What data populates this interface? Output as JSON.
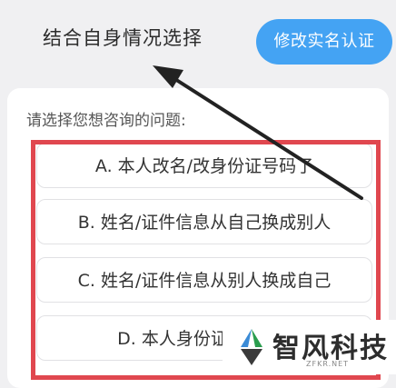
{
  "header": {
    "title": "结合自身情况选择",
    "verify_button": "修改实名认证"
  },
  "question": {
    "prompt": "请选择您想咨询的问题:",
    "options": [
      {
        "label": "A. 本人改名/改身份证号码了"
      },
      {
        "label": "B. 姓名/证件信息从自己换成别人"
      },
      {
        "label": "C. 姓名/证件信息从别人换成自己"
      },
      {
        "label": "D. 本人身份证"
      }
    ]
  },
  "annotation": {
    "highlight_color": "#e0474f",
    "arrow_color": "#222222"
  },
  "watermark": {
    "text": "智风科技",
    "sub": "ZFKR.NET",
    "icon": "zhifeng-logo-icon"
  },
  "colors": {
    "accent": "#44a3f3",
    "background": "#f0f0f2"
  }
}
